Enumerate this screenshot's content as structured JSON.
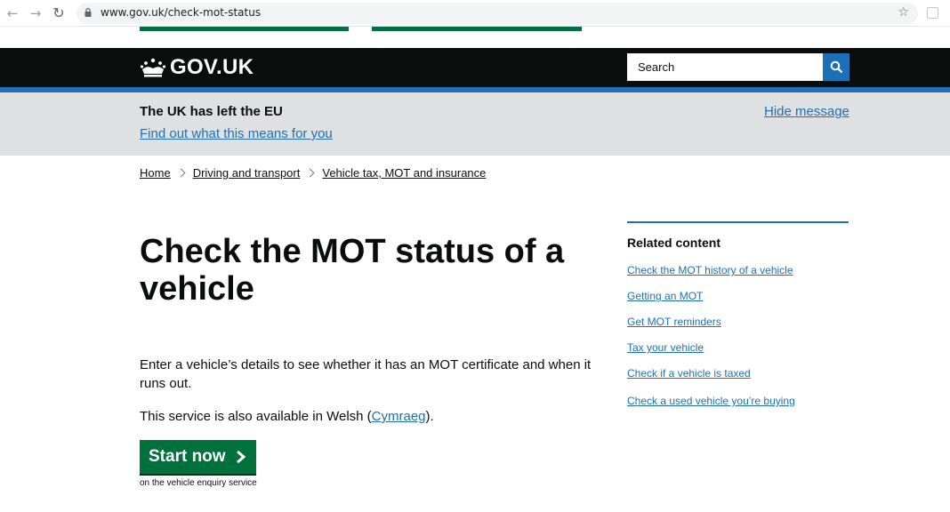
{
  "browser": {
    "url": "www.gov.uk/check-mot-status",
    "back_icon": "←",
    "forward_icon": "→",
    "reload_icon": "↻",
    "star_icon": "☆"
  },
  "header": {
    "logo_text": "GOV.UK",
    "search_placeholder": "Search"
  },
  "eu_banner": {
    "title": "The UK has left the EU",
    "link": "Find out what this means for you",
    "hide": "Hide message"
  },
  "breadcrumb": [
    "Home",
    "Driving and transport",
    "Vehicle tax, MOT and insurance"
  ],
  "main": {
    "title": "Check the MOT status of a vehicle",
    "intro": "Enter a vehicle’s details to see whether it has an MOT certificate and when it runs out.",
    "welsh_prefix": "This service is also available in Welsh (",
    "welsh_link": "Cymraeg",
    "welsh_suffix": ").",
    "start_button": "Start now",
    "start_hint": "on the vehicle enquiry service"
  },
  "related": {
    "title": "Related content",
    "links": [
      "Check the MOT history of a vehicle",
      "Getting an MOT",
      "Get MOT reminders",
      "Tax your vehicle",
      "Check if a vehicle is taxed",
      "Check a used vehicle you’re buying"
    ]
  },
  "colors": {
    "header_bg": "#0b0c0c",
    "brand_blue": "#1d70b8",
    "button_green": "#00703c",
    "banner_grey": "#dee0e2"
  }
}
